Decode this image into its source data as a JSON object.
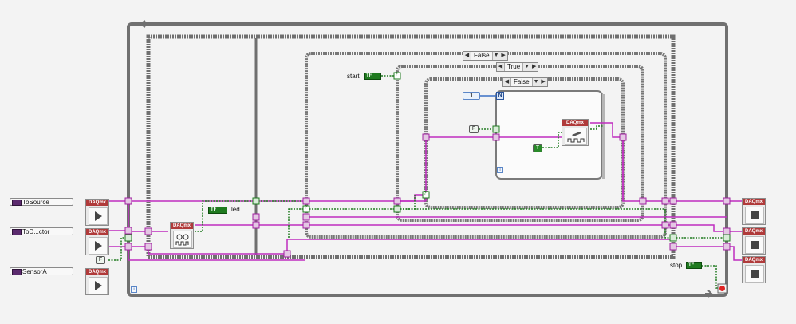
{
  "controls": {
    "to_source": "ToSource",
    "to_detector": "ToD...ctor",
    "sensor_a": "SensorA"
  },
  "indicators": {
    "led_label": "led",
    "start_label": "start",
    "stop_label": "stop",
    "bool_tag": "TF"
  },
  "nodes": {
    "daq_label": "DAQmx",
    "loop_iteration": "i",
    "for_count_terminal": "N",
    "for_count_value": "1",
    "false_constant": "F",
    "true_constant": "T",
    "selector_terminal": "?"
  },
  "case_structures": {
    "outer_case": "False",
    "middle_case": "True",
    "inner_case": "False",
    "arrow_prev": "◀",
    "arrow_next": "▶",
    "arrow_menu": "▼"
  },
  "colors": {
    "task_wire": "#c02cc0",
    "boolean_wire": "#1f7a1f",
    "daq_header": "#b03a3a",
    "structure_border": "#707070"
  }
}
